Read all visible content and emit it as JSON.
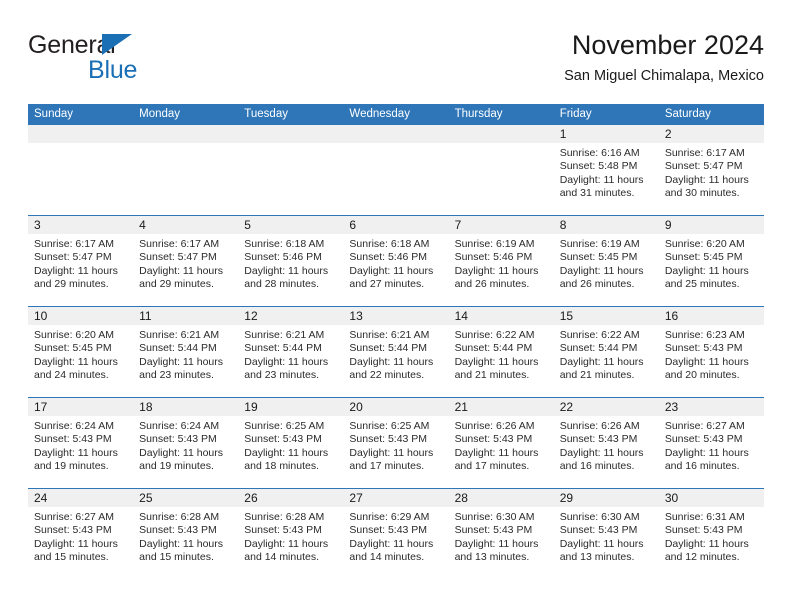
{
  "brand": {
    "word_general": "General",
    "word_blue": "Blue",
    "accent_color": "#1b6fb5",
    "triangle_icon": "triangle-icon"
  },
  "header": {
    "title": "November 2024",
    "subtitle": "San Miguel Chimalapa, Mexico"
  },
  "theme": {
    "header_blue": "#2e76b8",
    "day_band_gray": "#f0f0f0",
    "text": "#1a1a1a"
  },
  "calendar": {
    "weekday_headers": [
      "Sunday",
      "Monday",
      "Tuesday",
      "Wednesday",
      "Thursday",
      "Friday",
      "Saturday"
    ],
    "labels": {
      "sunrise": "Sunrise:",
      "sunset": "Sunset:",
      "daylight": "Daylight:"
    },
    "weeks": [
      [
        {
          "day": "",
          "sunrise": "",
          "sunset": "",
          "daylight_line1": "",
          "daylight_line2": ""
        },
        {
          "day": "",
          "sunrise": "",
          "sunset": "",
          "daylight_line1": "",
          "daylight_line2": ""
        },
        {
          "day": "",
          "sunrise": "",
          "sunset": "",
          "daylight_line1": "",
          "daylight_line2": ""
        },
        {
          "day": "",
          "sunrise": "",
          "sunset": "",
          "daylight_line1": "",
          "daylight_line2": ""
        },
        {
          "day": "",
          "sunrise": "",
          "sunset": "",
          "daylight_line1": "",
          "daylight_line2": ""
        },
        {
          "day": "1",
          "sunrise": "Sunrise: 6:16 AM",
          "sunset": "Sunset: 5:48 PM",
          "daylight_line1": "Daylight: 11 hours",
          "daylight_line2": "and 31 minutes."
        },
        {
          "day": "2",
          "sunrise": "Sunrise: 6:17 AM",
          "sunset": "Sunset: 5:47 PM",
          "daylight_line1": "Daylight: 11 hours",
          "daylight_line2": "and 30 minutes."
        }
      ],
      [
        {
          "day": "3",
          "sunrise": "Sunrise: 6:17 AM",
          "sunset": "Sunset: 5:47 PM",
          "daylight_line1": "Daylight: 11 hours",
          "daylight_line2": "and 29 minutes."
        },
        {
          "day": "4",
          "sunrise": "Sunrise: 6:17 AM",
          "sunset": "Sunset: 5:47 PM",
          "daylight_line1": "Daylight: 11 hours",
          "daylight_line2": "and 29 minutes."
        },
        {
          "day": "5",
          "sunrise": "Sunrise: 6:18 AM",
          "sunset": "Sunset: 5:46 PM",
          "daylight_line1": "Daylight: 11 hours",
          "daylight_line2": "and 28 minutes."
        },
        {
          "day": "6",
          "sunrise": "Sunrise: 6:18 AM",
          "sunset": "Sunset: 5:46 PM",
          "daylight_line1": "Daylight: 11 hours",
          "daylight_line2": "and 27 minutes."
        },
        {
          "day": "7",
          "sunrise": "Sunrise: 6:19 AM",
          "sunset": "Sunset: 5:46 PM",
          "daylight_line1": "Daylight: 11 hours",
          "daylight_line2": "and 26 minutes."
        },
        {
          "day": "8",
          "sunrise": "Sunrise: 6:19 AM",
          "sunset": "Sunset: 5:45 PM",
          "daylight_line1": "Daylight: 11 hours",
          "daylight_line2": "and 26 minutes."
        },
        {
          "day": "9",
          "sunrise": "Sunrise: 6:20 AM",
          "sunset": "Sunset: 5:45 PM",
          "daylight_line1": "Daylight: 11 hours",
          "daylight_line2": "and 25 minutes."
        }
      ],
      [
        {
          "day": "10",
          "sunrise": "Sunrise: 6:20 AM",
          "sunset": "Sunset: 5:45 PM",
          "daylight_line1": "Daylight: 11 hours",
          "daylight_line2": "and 24 minutes."
        },
        {
          "day": "11",
          "sunrise": "Sunrise: 6:21 AM",
          "sunset": "Sunset: 5:44 PM",
          "daylight_line1": "Daylight: 11 hours",
          "daylight_line2": "and 23 minutes."
        },
        {
          "day": "12",
          "sunrise": "Sunrise: 6:21 AM",
          "sunset": "Sunset: 5:44 PM",
          "daylight_line1": "Daylight: 11 hours",
          "daylight_line2": "and 23 minutes."
        },
        {
          "day": "13",
          "sunrise": "Sunrise: 6:21 AM",
          "sunset": "Sunset: 5:44 PM",
          "daylight_line1": "Daylight: 11 hours",
          "daylight_line2": "and 22 minutes."
        },
        {
          "day": "14",
          "sunrise": "Sunrise: 6:22 AM",
          "sunset": "Sunset: 5:44 PM",
          "daylight_line1": "Daylight: 11 hours",
          "daylight_line2": "and 21 minutes."
        },
        {
          "day": "15",
          "sunrise": "Sunrise: 6:22 AM",
          "sunset": "Sunset: 5:44 PM",
          "daylight_line1": "Daylight: 11 hours",
          "daylight_line2": "and 21 minutes."
        },
        {
          "day": "16",
          "sunrise": "Sunrise: 6:23 AM",
          "sunset": "Sunset: 5:43 PM",
          "daylight_line1": "Daylight: 11 hours",
          "daylight_line2": "and 20 minutes."
        }
      ],
      [
        {
          "day": "17",
          "sunrise": "Sunrise: 6:24 AM",
          "sunset": "Sunset: 5:43 PM",
          "daylight_line1": "Daylight: 11 hours",
          "daylight_line2": "and 19 minutes."
        },
        {
          "day": "18",
          "sunrise": "Sunrise: 6:24 AM",
          "sunset": "Sunset: 5:43 PM",
          "daylight_line1": "Daylight: 11 hours",
          "daylight_line2": "and 19 minutes."
        },
        {
          "day": "19",
          "sunrise": "Sunrise: 6:25 AM",
          "sunset": "Sunset: 5:43 PM",
          "daylight_line1": "Daylight: 11 hours",
          "daylight_line2": "and 18 minutes."
        },
        {
          "day": "20",
          "sunrise": "Sunrise: 6:25 AM",
          "sunset": "Sunset: 5:43 PM",
          "daylight_line1": "Daylight: 11 hours",
          "daylight_line2": "and 17 minutes."
        },
        {
          "day": "21",
          "sunrise": "Sunrise: 6:26 AM",
          "sunset": "Sunset: 5:43 PM",
          "daylight_line1": "Daylight: 11 hours",
          "daylight_line2": "and 17 minutes."
        },
        {
          "day": "22",
          "sunrise": "Sunrise: 6:26 AM",
          "sunset": "Sunset: 5:43 PM",
          "daylight_line1": "Daylight: 11 hours",
          "daylight_line2": "and 16 minutes."
        },
        {
          "day": "23",
          "sunrise": "Sunrise: 6:27 AM",
          "sunset": "Sunset: 5:43 PM",
          "daylight_line1": "Daylight: 11 hours",
          "daylight_line2": "and 16 minutes."
        }
      ],
      [
        {
          "day": "24",
          "sunrise": "Sunrise: 6:27 AM",
          "sunset": "Sunset: 5:43 PM",
          "daylight_line1": "Daylight: 11 hours",
          "daylight_line2": "and 15 minutes."
        },
        {
          "day": "25",
          "sunrise": "Sunrise: 6:28 AM",
          "sunset": "Sunset: 5:43 PM",
          "daylight_line1": "Daylight: 11 hours",
          "daylight_line2": "and 15 minutes."
        },
        {
          "day": "26",
          "sunrise": "Sunrise: 6:28 AM",
          "sunset": "Sunset: 5:43 PM",
          "daylight_line1": "Daylight: 11 hours",
          "daylight_line2": "and 14 minutes."
        },
        {
          "day": "27",
          "sunrise": "Sunrise: 6:29 AM",
          "sunset": "Sunset: 5:43 PM",
          "daylight_line1": "Daylight: 11 hours",
          "daylight_line2": "and 14 minutes."
        },
        {
          "day": "28",
          "sunrise": "Sunrise: 6:30 AM",
          "sunset": "Sunset: 5:43 PM",
          "daylight_line1": "Daylight: 11 hours",
          "daylight_line2": "and 13 minutes."
        },
        {
          "day": "29",
          "sunrise": "Sunrise: 6:30 AM",
          "sunset": "Sunset: 5:43 PM",
          "daylight_line1": "Daylight: 11 hours",
          "daylight_line2": "and 13 minutes."
        },
        {
          "day": "30",
          "sunrise": "Sunrise: 6:31 AM",
          "sunset": "Sunset: 5:43 PM",
          "daylight_line1": "Daylight: 11 hours",
          "daylight_line2": "and 12 minutes."
        }
      ]
    ]
  }
}
